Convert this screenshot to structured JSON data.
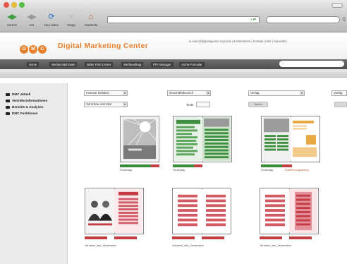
{
  "browser": {
    "toolbar": [
      {
        "label": "Zurück",
        "icon": "back-icon"
      },
      {
        "label": "Vor",
        "icon": "forward-icon"
      },
      {
        "label": "Neu laden",
        "icon": "reload-icon"
      },
      {
        "label": "Stopp",
        "icon": "stop-icon"
      },
      {
        "label": "Startseite",
        "icon": "home-icon"
      }
    ],
    "url": "",
    "search_value": "Q"
  },
  "site": {
    "logo_letters": [
      "D",
      "M",
      "C"
    ],
    "title": "Digital Marketing Center",
    "header_links": "in.mein@digitalagentur.nopcode  |  ♥ Warenkorb  |  Kontakt  |  Hilfe  |  Abmelden",
    "nav": [
      {
        "label": "Home"
      },
      {
        "label": "Werbemittel-Datei"
      },
      {
        "label": "Bilder Print Center"
      },
      {
        "label": "Werbeauftrag"
      },
      {
        "label": "PFF Manager"
      },
      {
        "label": "Archiv Formular"
      }
    ],
    "nav_search_placeholder": ""
  },
  "sidebar": {
    "items": [
      {
        "label": "DMC aktuell"
      },
      {
        "label": "Vertriebsinformationen"
      },
      {
        "label": "Berichte & Analysen"
      },
      {
        "label": "DMC Funktionen"
      }
    ]
  },
  "filters": {
    "row1": [
      {
        "value": "Investor Relation",
        "type": "select"
      },
      {
        "value": "Geschäftsbereich",
        "type": "select"
      },
      {
        "value": "Verlag",
        "type": "select"
      },
      {
        "value": "Verlag",
        "type": "select"
      }
    ],
    "row2": {
      "sort_value": "Vorschau und Stat",
      "text_label": "Texte",
      "search_button": "Suche",
      "extra_button": ""
    }
  },
  "documents": [
    {
      "caption": "Vorschlag",
      "kind": "single-photo"
    },
    {
      "caption": "Vorschlag",
      "kind": "pair-green"
    },
    {
      "caption": "Vorschlag",
      "kind": "pair-orange",
      "caption2": "Zustimmungsantrag"
    },
    {
      "caption": "Vorname_des_Versenders",
      "kind": "pair-people"
    },
    {
      "caption": "Vorname_des_Versenders",
      "kind": "pair-red"
    },
    {
      "caption": "Vorname_des_Versenders",
      "kind": "pair-red2"
    }
  ],
  "colors": {
    "brand_orange": "#e8812e",
    "approved_green": "#3a8c3a",
    "pending_red": "#c43d45",
    "nav_dark": "#4d4d4d"
  }
}
